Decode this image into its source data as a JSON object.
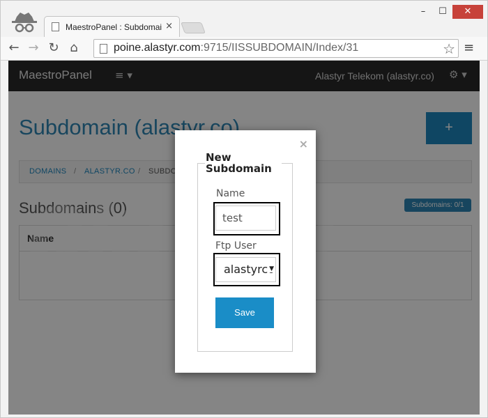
{
  "browser": {
    "tab_title": "MaestroPanel : Subdomain",
    "tab_close": "×",
    "url_host": "poine.alastyr.com",
    "url_path": ":9715/IISSUBDOMAIN/Index/31",
    "minimize": "–",
    "maximize": "☐",
    "close": "✕",
    "back": "←",
    "forward": "→",
    "reload": "↻",
    "home": "⌂",
    "star": "☆",
    "menu": "≡"
  },
  "navbar": {
    "brand": "MaestroPanel",
    "toggle": "≡ ▾",
    "user": "Alastyr Telekom (alastyr.co)",
    "gear": "⚙ ▾"
  },
  "page": {
    "title": "Subdomain (alastyr.co)",
    "add_button": "+",
    "watermark": "alastyr",
    "breadcrumb": {
      "domains": "DOMAINS",
      "sep1": "/",
      "domain": "ALASTYR.CO",
      "sep2": "/",
      "current": "SUBDO"
    },
    "section_title": "Subdomains (0)",
    "count_badge": "Subdomains: 0/1",
    "table_header_name": "Name"
  },
  "modal": {
    "close": "×",
    "legend": "New Subdomain",
    "name_label": "Name",
    "name_value": "test",
    "ftp_label": "Ftp User",
    "ftp_value": "alastyrco",
    "save_label": "Save"
  },
  "icons": {
    "tab": "document-icon",
    "window_minimize": "minimize-icon",
    "window_maximize": "maximize-icon",
    "window_close": "close-icon",
    "back": "back-arrow-icon",
    "forward": "forward-arrow-icon",
    "reload": "reload-icon",
    "home": "home-icon",
    "bookmark": "star-icon",
    "browser_menu": "hamburger-icon",
    "nav_toggle": "hamburger-icon",
    "settings": "gear-icon",
    "profile": "incognito-icon"
  },
  "colors": {
    "accent": "#1d87bf",
    "navbar": "#2a2a2a",
    "window_close": "#c7423a"
  }
}
